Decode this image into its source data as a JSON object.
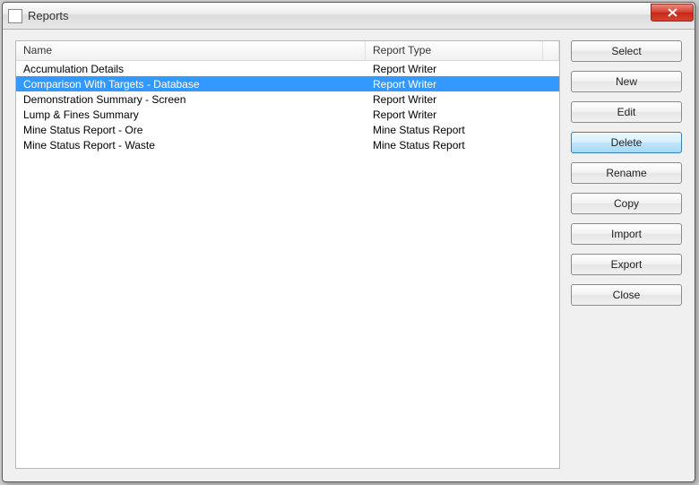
{
  "window": {
    "title": "Reports"
  },
  "list": {
    "columns": {
      "name": "Name",
      "type": "Report Type"
    },
    "rows": [
      {
        "name": "Accumulation Details",
        "type": "Report Writer",
        "selected": false
      },
      {
        "name": "Comparison With Targets - Database",
        "type": "Report Writer",
        "selected": true
      },
      {
        "name": "Demonstration Summary - Screen",
        "type": "Report Writer",
        "selected": false
      },
      {
        "name": "Lump & Fines Summary",
        "type": "Report Writer",
        "selected": false
      },
      {
        "name": "Mine Status Report - Ore",
        "type": "Mine Status Report",
        "selected": false
      },
      {
        "name": "Mine Status Report - Waste",
        "type": "Mine Status Report",
        "selected": false
      }
    ]
  },
  "buttons": {
    "select": "Select",
    "new": "New",
    "edit": "Edit",
    "delete": "Delete",
    "rename": "Rename",
    "copy": "Copy",
    "import": "Import",
    "export": "Export",
    "close": "Close",
    "focused": "delete"
  }
}
